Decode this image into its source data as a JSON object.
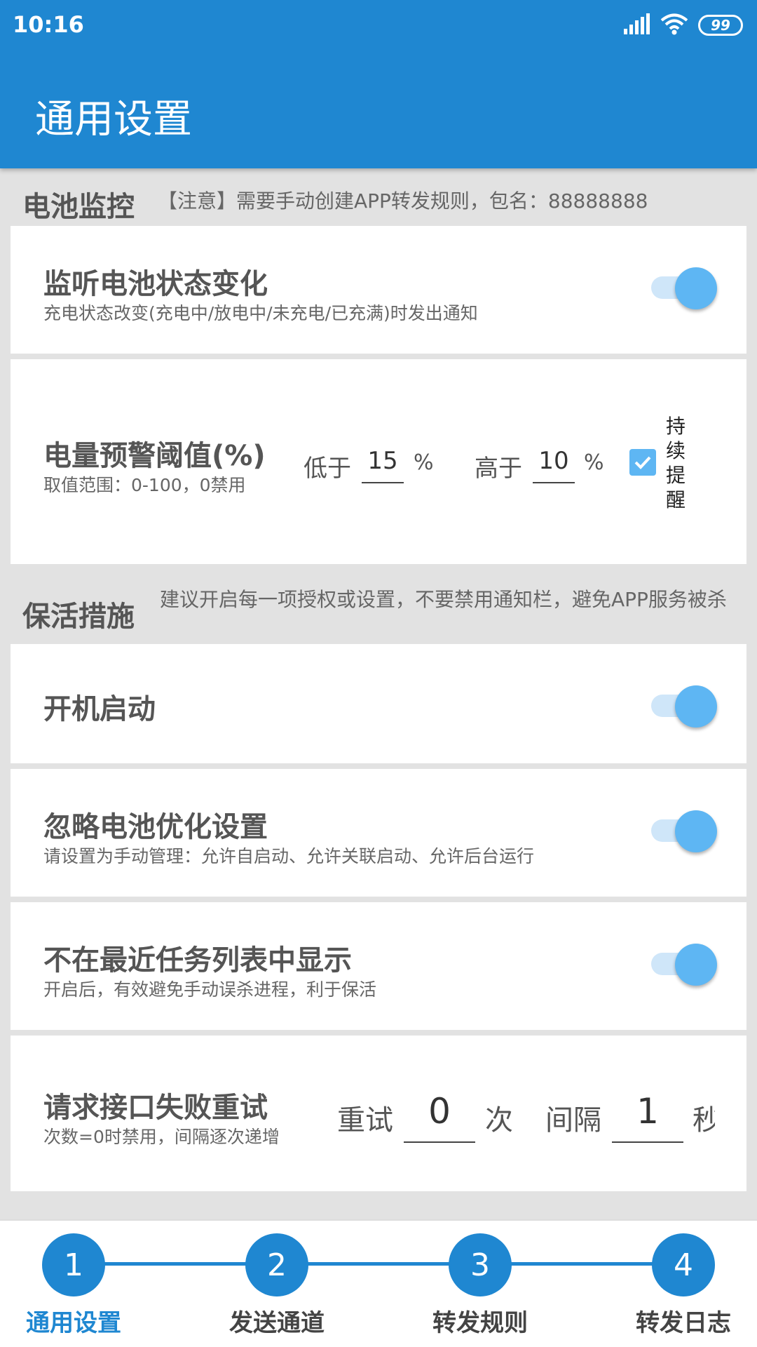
{
  "status_bar": {
    "time": "10:16",
    "battery": "99"
  },
  "header": {
    "title": "通用设置"
  },
  "battery_section": {
    "title": "电池监控",
    "note": "【注意】需要手动创建APP转发规则，包名：88888888",
    "listen_row": {
      "title": "监听电池状态变化",
      "subtitle": "充电状态改变(充电中/放电中/未充电/已充满)时发出通知",
      "switch_on": true
    },
    "threshold_row": {
      "title": "电量预警阈值(%)",
      "subtitle": "取值范围：0-100，0禁用",
      "low_label": "低于",
      "low_value": "15",
      "low_unit": "%",
      "high_label": "高于",
      "high_value": "10",
      "high_unit": "%",
      "persist_label": "持续提醒",
      "persist_checked": true
    }
  },
  "keepalive_section": {
    "title": "保活措施",
    "note": "建议开启每一项授权或设置，不要禁用通知栏，避免APP服务被杀",
    "boot_row": {
      "title": "开机启动",
      "switch_on": true
    },
    "battery_opt_row": {
      "title": "忽略电池优化设置",
      "subtitle": "请设置为手动管理：允许自启动、允许关联启动、允许后台运行",
      "switch_on": true
    },
    "recent_row": {
      "title": "不在最近任务列表中显示",
      "subtitle": "开启后，有效避免手动误杀进程，利于保活",
      "switch_on": true
    },
    "retry_row": {
      "title": "请求接口失败重试",
      "subtitle": "次数=0时禁用，间隔逐次递增",
      "retry_label": "重试",
      "retry_value": "0",
      "retry_unit": "次",
      "interval_label": "间隔",
      "interval_value": "1",
      "interval_unit": "秒"
    }
  },
  "steps": [
    {
      "number": "1",
      "label": "通用设置",
      "active": true
    },
    {
      "number": "2",
      "label": "发送通道",
      "active": false
    },
    {
      "number": "3",
      "label": "转发规则",
      "active": false
    },
    {
      "number": "4",
      "label": "转发日志",
      "active": false
    }
  ],
  "colors": {
    "primary": "#1f87d1",
    "switch_thumb": "#5eb6f3",
    "switch_track": "#cfe6f9",
    "background": "#e2e2e2"
  }
}
